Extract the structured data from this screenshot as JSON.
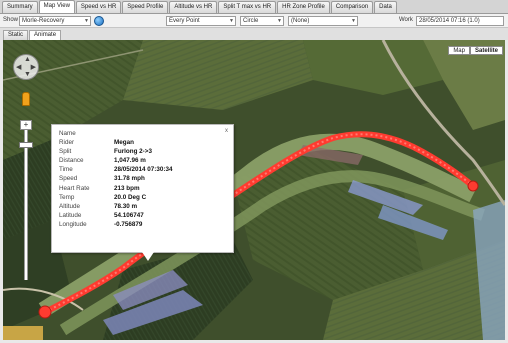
{
  "tabs": [
    {
      "label": "Summary"
    },
    {
      "label": "Map View",
      "active": true
    },
    {
      "label": "Speed vs HR"
    },
    {
      "label": "Speed Profile"
    },
    {
      "label": "Altitude vs HR"
    },
    {
      "label": "Split T max vs HR"
    },
    {
      "label": "HR Zone Profile"
    },
    {
      "label": "Comparison"
    },
    {
      "label": "Data"
    }
  ],
  "toolbar": {
    "show_label": "Show",
    "show_value": "Morle-Recovery",
    "point_select": "Every Point",
    "marker_select": "Circle",
    "none_select": "(None)",
    "work_label": "Work",
    "work_value": "28/05/2014 07:16 (1.0)"
  },
  "subtabs": [
    {
      "label": "Static"
    },
    {
      "label": "Animate",
      "active": true
    }
  ],
  "map_types": [
    {
      "label": "Map"
    },
    {
      "label": "Satellite",
      "active": true
    }
  ],
  "popup": {
    "close": "x",
    "rows": [
      {
        "key": "Name",
        "value": ""
      },
      {
        "key": "Rider",
        "value": "Megan"
      },
      {
        "key": "Split",
        "value": "Furlong 2->3"
      },
      {
        "key": "Distance",
        "value": "1,047.96 m"
      },
      {
        "key": "Time",
        "value": "28/05/2014 07:30:34"
      },
      {
        "key": "Speed",
        "value": "31.78 mph"
      },
      {
        "key": "Heart Rate",
        "value": "213 bpm"
      },
      {
        "key": "Temp",
        "value": "20.0 Deg C"
      },
      {
        "key": "Altitude",
        "value": "78.30 m"
      },
      {
        "key": "Latitude",
        "value": "54.106747"
      },
      {
        "key": "Longitude",
        "value": "-0.756879"
      }
    ]
  },
  "colors": {
    "track": "#ff3b30",
    "map_dark": "#3d4d2a"
  }
}
